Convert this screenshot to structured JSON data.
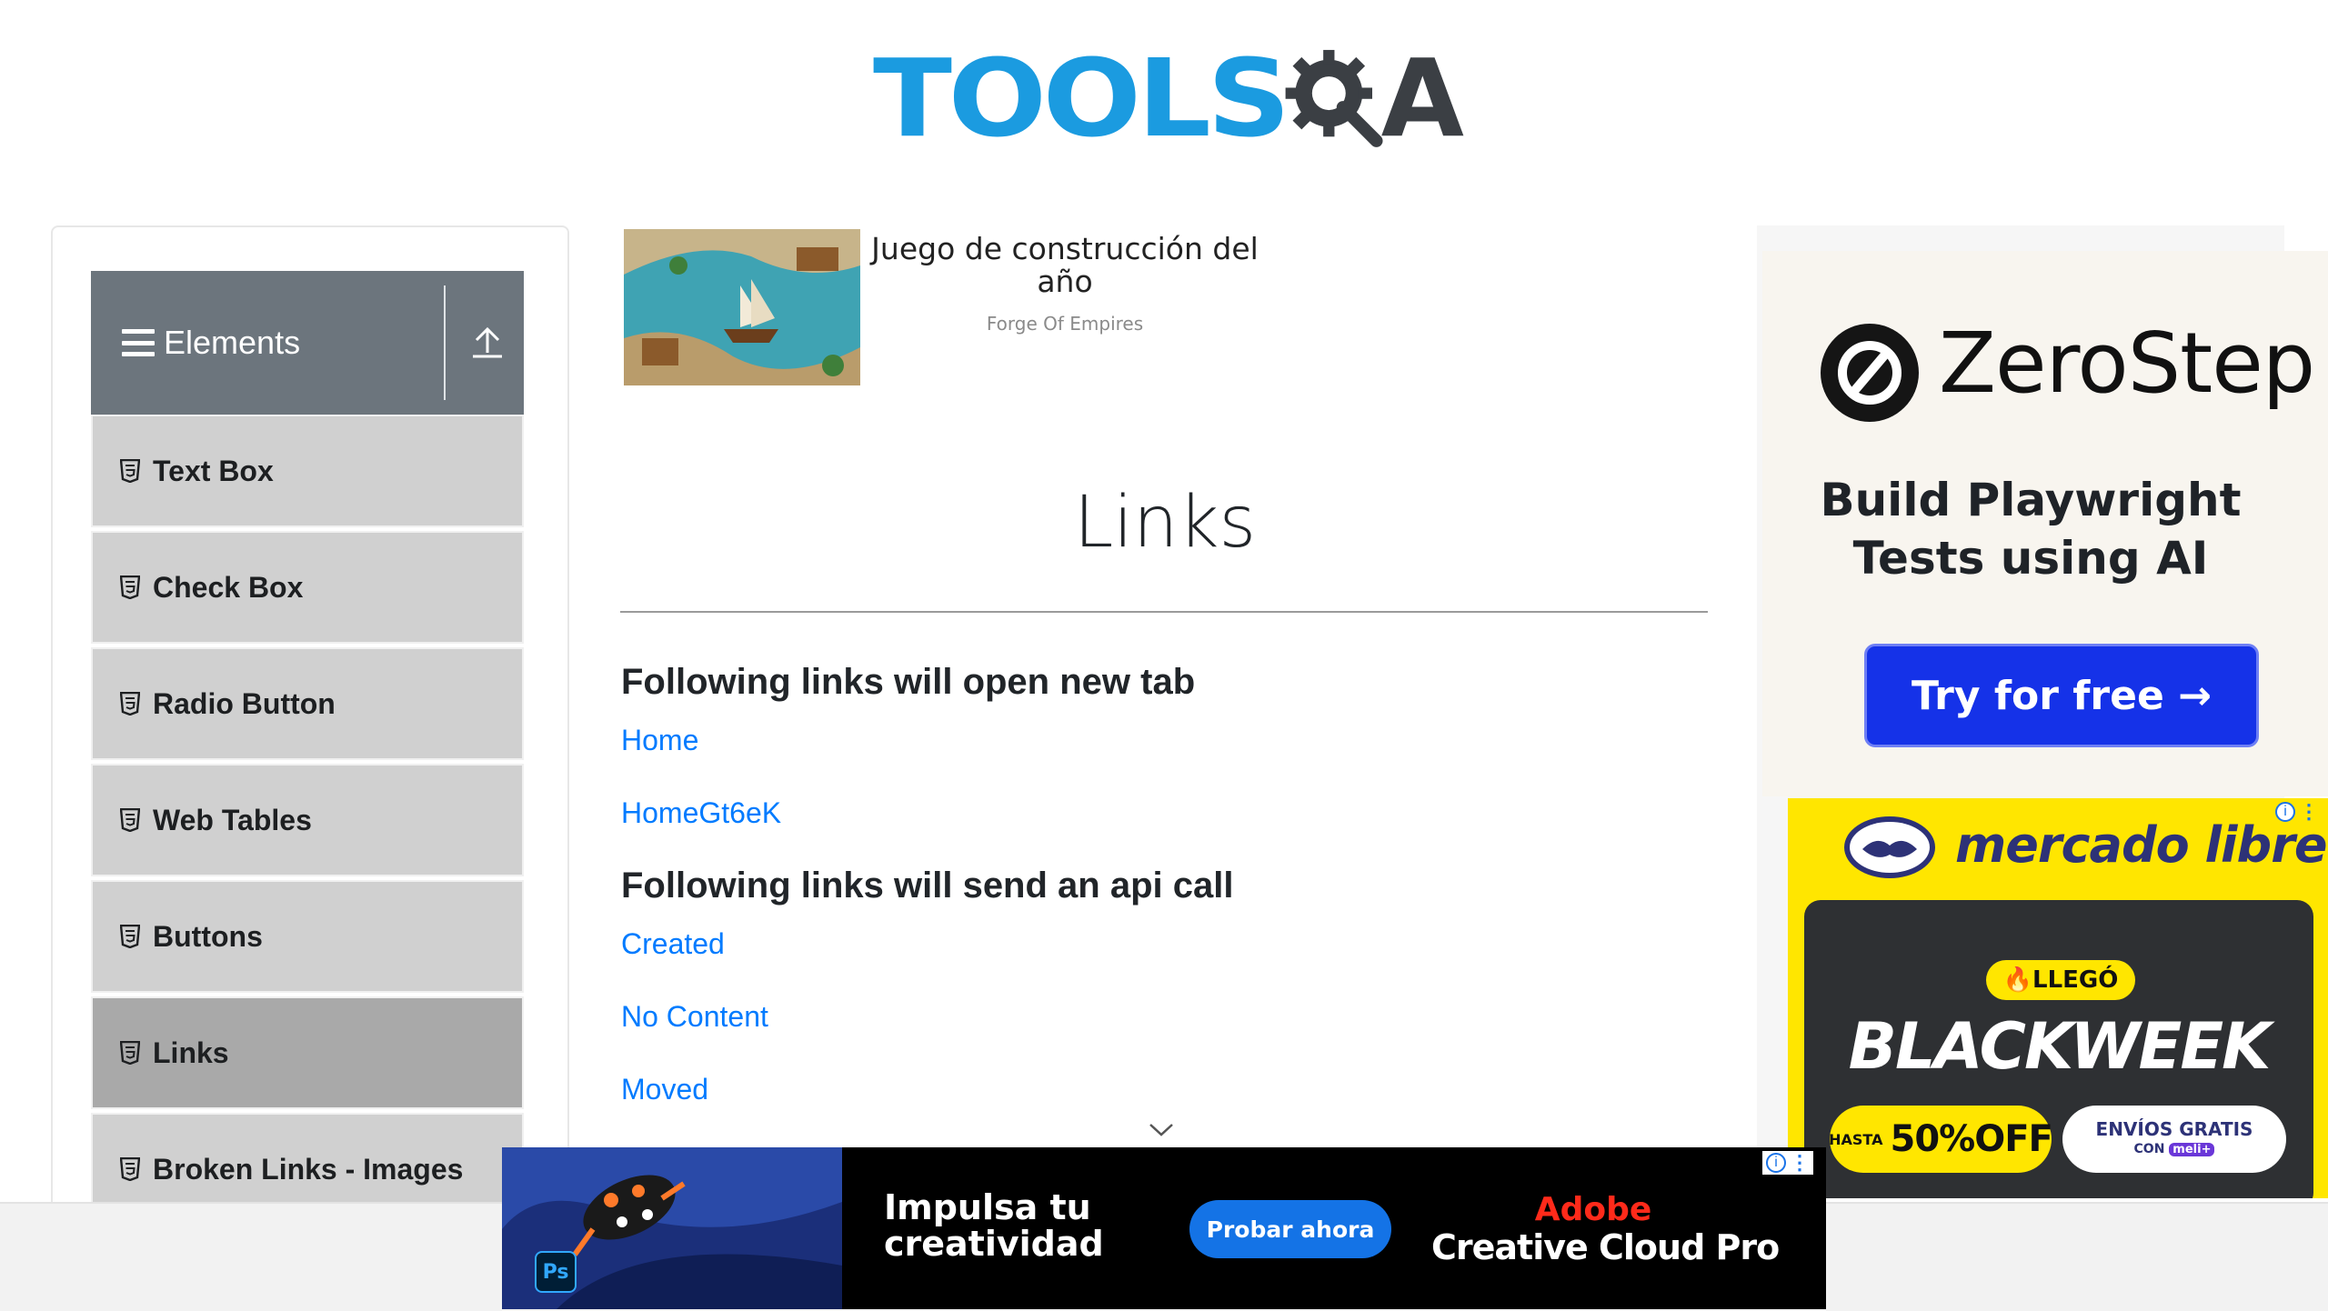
{
  "header": {
    "logo_part1": "TOOLS",
    "logo_part2": "A"
  },
  "sidebar": {
    "group_title": "Elements",
    "items": [
      {
        "label": "Text Box",
        "active": false
      },
      {
        "label": "Check Box",
        "active": false
      },
      {
        "label": "Radio Button",
        "active": false
      },
      {
        "label": "Web Tables",
        "active": false
      },
      {
        "label": "Buttons",
        "active": false
      },
      {
        "label": "Links",
        "active": true
      },
      {
        "label": "Broken Links - Images",
        "active": false
      }
    ]
  },
  "top_ad": {
    "title": "Juego de construcción del año",
    "source": "Forge Of Empires"
  },
  "main": {
    "page_title": "Links",
    "section1_heading": "Following links will open new tab",
    "section1_links": [
      "Home",
      "HomeGt6eK"
    ],
    "section2_heading": "Following links will send an api call",
    "section2_links": [
      "Created",
      "No Content",
      "Moved"
    ]
  },
  "right_ad_zerostep": {
    "brand": "ZeroStep",
    "tagline_line1": "Build Playwright",
    "tagline_line2": "Tests using AI",
    "cta": "Try for free →"
  },
  "right_ad_mercadolibre": {
    "brand": "mercado libre",
    "badge": "🔥LLEGÓ",
    "headline": "BLACKWEEK",
    "discount_prefix": "HASTA",
    "discount": "50%OFF",
    "shipping": "ENVÍOS GRATIS",
    "shipping_con": "CON",
    "shipping_meli": "meli+"
  },
  "bottom_ad": {
    "ps_badge": "Ps",
    "headline_line1": "Impulsa tu",
    "headline_line2": "creatividad",
    "cta": "Probar ahora",
    "brand": "Adobe",
    "product": "Creative Cloud Pro"
  },
  "colors": {
    "brand_blue": "#1b9be0",
    "link": "#007bff",
    "group_header": "#6c757d",
    "menu_item": "#d0d0d0",
    "menu_item_active": "#a9a9a9",
    "zerostep_cta": "#1532e8",
    "mercado_yellow": "#ffe600"
  },
  "icons": {
    "menu": "hamburger-icon",
    "collapse": "arrow-up-icon",
    "item": "html5-icon",
    "scroll": "chevron-down-icon"
  }
}
